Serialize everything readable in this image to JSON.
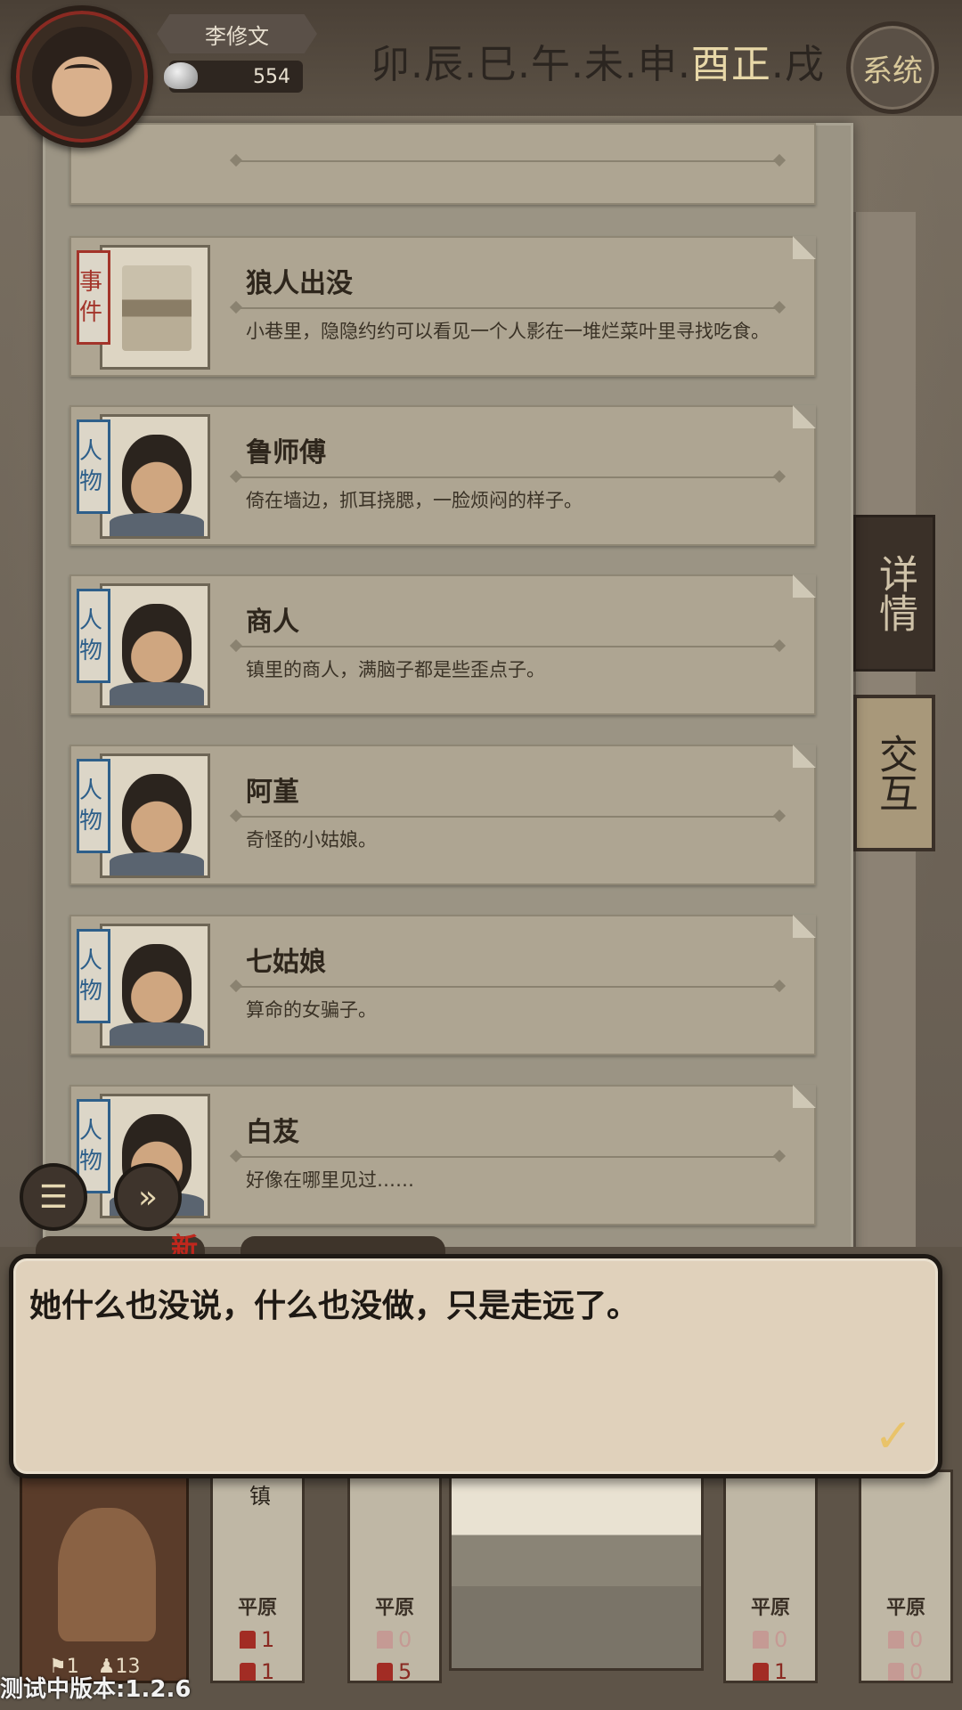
{
  "player": {
    "name": "李修文",
    "silver": "554"
  },
  "time": {
    "before": "卯.辰.巳.午.未.申.",
    "current": "酉正",
    "after": ".戌"
  },
  "system_button": "系统",
  "side_tabs": {
    "details": "详情",
    "interact": "交互"
  },
  "cards": [
    {
      "tag": "事件",
      "title": "狼人出没",
      "desc": "小巷里，隐隐约约可以看见一个人影在一堆烂菜叶里寻找吃食。",
      "kind": "event"
    },
    {
      "tag": "人物",
      "title": "鲁师傅",
      "desc": "倚在墙边，抓耳挠腮，一脸烦闷的样子。",
      "kind": "person"
    },
    {
      "tag": "人物",
      "title": "商人",
      "desc": "镇里的商人，满脑子都是些歪点子。",
      "kind": "person"
    },
    {
      "tag": "人物",
      "title": "阿堇",
      "desc": "奇怪的小姑娘。",
      "kind": "person"
    },
    {
      "tag": "人物",
      "title": "七姑娘",
      "desc": "算命的女骗子。",
      "kind": "person"
    },
    {
      "tag": "人物",
      "title": "白芨",
      "desc": "好像在哪里见过……",
      "kind": "person"
    }
  ],
  "new_badge": "新",
  "dialog": {
    "text": "她什么也没说，什么也没做，只是走远了。"
  },
  "map": {
    "cart_stats": {
      "a": "1",
      "b": "13"
    },
    "town_label": "镇",
    "pillars": [
      {
        "name": "平原",
        "v1": "1",
        "v2": "1"
      },
      {
        "name": "平原",
        "v1": "0",
        "v2": "5"
      },
      {
        "name": "平原",
        "v1": "0",
        "v2": "1"
      },
      {
        "name": "平原",
        "v1": "0",
        "v2": "0"
      }
    ]
  },
  "version": "测试中版本:1.2.6",
  "colors": {
    "event_tag": "#a3342a",
    "person_tag": "#2e5f8a",
    "current_time": "#e8d8a8"
  }
}
